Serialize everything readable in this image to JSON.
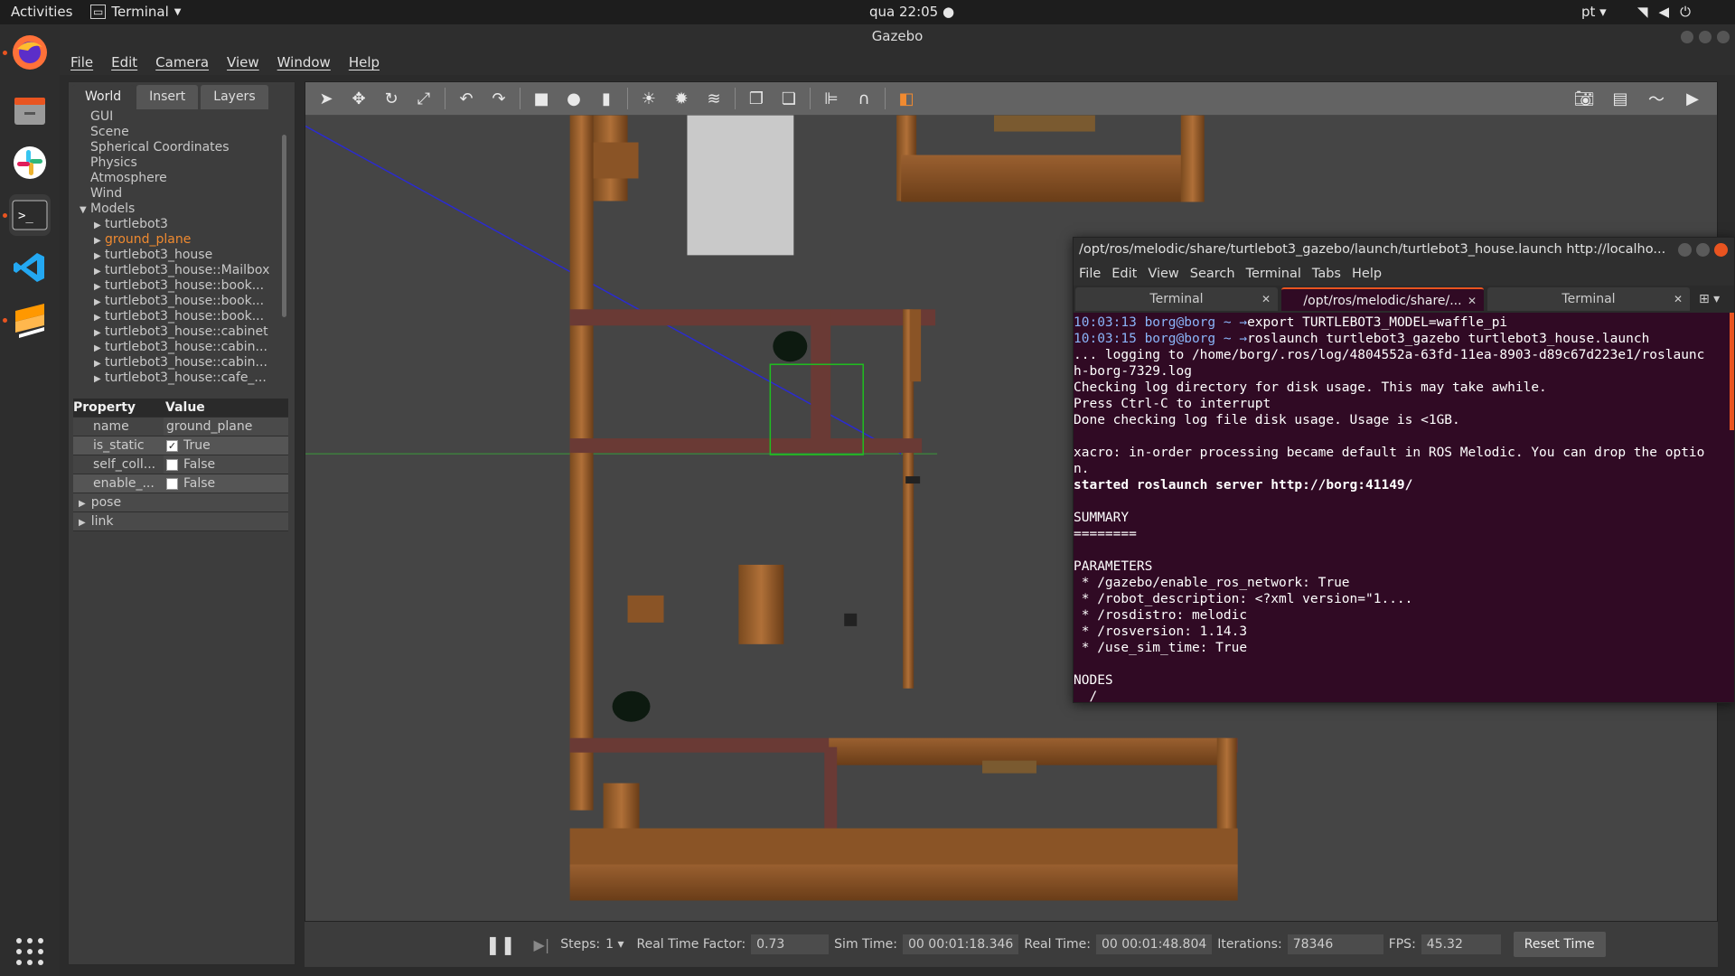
{
  "topbar": {
    "activities": "Activities",
    "app_name": "Terminal",
    "clock": "qua 22:05 ●",
    "lang": "pt ▾"
  },
  "window": {
    "title": "Gazebo"
  },
  "menubar": [
    "File",
    "Edit",
    "Camera",
    "View",
    "Window",
    "Help"
  ],
  "leftpanel": {
    "tabs": [
      "World",
      "Insert",
      "Layers"
    ],
    "tree": [
      {
        "label": "GUI",
        "indent": 0,
        "arrow": ""
      },
      {
        "label": "Scene",
        "indent": 0,
        "arrow": ""
      },
      {
        "label": "Spherical Coordinates",
        "indent": 0,
        "arrow": ""
      },
      {
        "label": "Physics",
        "indent": 0,
        "arrow": ""
      },
      {
        "label": "Atmosphere",
        "indent": 0,
        "arrow": ""
      },
      {
        "label": "Wind",
        "indent": 0,
        "arrow": ""
      },
      {
        "label": "Models",
        "indent": 0,
        "arrow": "▼"
      },
      {
        "label": "turtlebot3",
        "indent": 1,
        "arrow": "▶"
      },
      {
        "label": "ground_plane",
        "indent": 1,
        "arrow": "▶",
        "selected": true
      },
      {
        "label": "turtlebot3_house",
        "indent": 1,
        "arrow": "▶"
      },
      {
        "label": "turtlebot3_house::Mailbox",
        "indent": 1,
        "arrow": "▶"
      },
      {
        "label": "turtlebot3_house::book...",
        "indent": 1,
        "arrow": "▶"
      },
      {
        "label": "turtlebot3_house::book...",
        "indent": 1,
        "arrow": "▶"
      },
      {
        "label": "turtlebot3_house::book...",
        "indent": 1,
        "arrow": "▶"
      },
      {
        "label": "turtlebot3_house::cabinet",
        "indent": 1,
        "arrow": "▶"
      },
      {
        "label": "turtlebot3_house::cabin...",
        "indent": 1,
        "arrow": "▶"
      },
      {
        "label": "turtlebot3_house::cabin...",
        "indent": 1,
        "arrow": "▶"
      },
      {
        "label": "turtlebot3_house::cafe_...",
        "indent": 1,
        "arrow": "▶"
      }
    ],
    "props_header": {
      "property": "Property",
      "value": "Value"
    },
    "props": [
      {
        "k": "name",
        "v": "ground_plane",
        "checkbox": null
      },
      {
        "k": "is_static",
        "v": "True",
        "checkbox": true
      },
      {
        "k": "self_coll...",
        "v": "False",
        "checkbox": false
      },
      {
        "k": "enable_...",
        "v": "False",
        "checkbox": false
      }
    ],
    "expandables": [
      "pose",
      "link"
    ]
  },
  "status": {
    "steps_label": "Steps:",
    "steps_value": "1 ▾",
    "rtf_label": "Real Time Factor:",
    "rtf_value": "0.73",
    "sim_label": "Sim Time:",
    "sim_value": "00 00:01:18.346",
    "real_label": "Real Time:",
    "real_value": "00 00:01:48.804",
    "iter_label": "Iterations:",
    "iter_value": "78346",
    "fps_label": "FPS:",
    "fps_value": "45.32",
    "reset": "Reset Time"
  },
  "terminal": {
    "title": "/opt/ros/melodic/share/turtlebot3_gazebo/launch/turtlebot3_house.launch http://localho...",
    "menu": [
      "File",
      "Edit",
      "View",
      "Search",
      "Terminal",
      "Tabs",
      "Help"
    ],
    "tabs": [
      "Terminal",
      "/opt/ros/melodic/share/...",
      "Terminal"
    ],
    "lines": [
      {
        "time": "10:03:13",
        "user": "borg@borg ~ →",
        "cmd": "export TURTLEBOT3_MODEL=waffle_pi"
      },
      {
        "time": "10:03:15",
        "user": "borg@borg ~ →",
        "cmd": "roslaunch turtlebot3_gazebo turtlebot3_house.launch"
      },
      {
        "text": "... logging to /home/borg/.ros/log/4804552a-63fd-11ea-8903-d89c67d223e1/roslaunc"
      },
      {
        "text": "h-borg-7329.log"
      },
      {
        "text": "Checking log directory for disk usage. This may take awhile."
      },
      {
        "text": "Press Ctrl-C to interrupt"
      },
      {
        "text": "Done checking log file disk usage. Usage is <1GB."
      },
      {
        "text": ""
      },
      {
        "text": "xacro: in-order processing became default in ROS Melodic. You can drop the optio"
      },
      {
        "text": "n."
      },
      {
        "text": "started roslaunch server http://borg:41149/",
        "bold": true
      },
      {
        "text": ""
      },
      {
        "text": "SUMMARY"
      },
      {
        "text": "========"
      },
      {
        "text": ""
      },
      {
        "text": "PARAMETERS"
      },
      {
        "text": " * /gazebo/enable_ros_network: True"
      },
      {
        "text": " * /robot_description: <?xml version=\"1...."
      },
      {
        "text": " * /rosdistro: melodic"
      },
      {
        "text": " * /rosversion: 1.14.3"
      },
      {
        "text": " * /use_sim_time: True"
      },
      {
        "text": ""
      },
      {
        "text": "NODES"
      },
      {
        "text": "  /"
      }
    ]
  },
  "colors": {
    "accent": "#e95420",
    "selected_tree": "#f08a30",
    "terminal_bg": "#300a24"
  }
}
